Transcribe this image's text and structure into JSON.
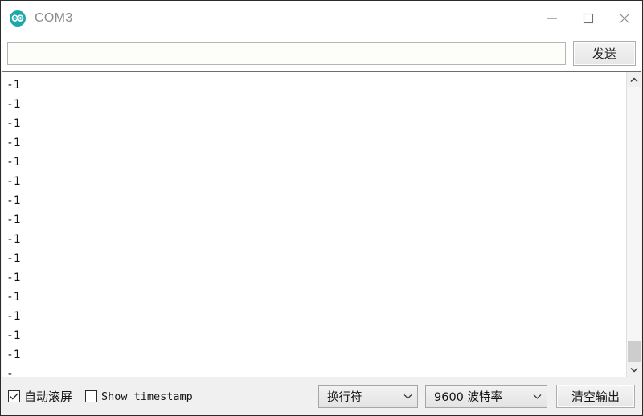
{
  "window": {
    "title": "COM3",
    "app_icon": "arduino-infinity-icon",
    "accent_color": "#00979c",
    "controls": {
      "minimize": "minimize-icon",
      "maximize": "maximize-icon",
      "close": "close-icon"
    }
  },
  "send_row": {
    "input_value": "",
    "input_placeholder": "",
    "send_label": "发送"
  },
  "console": {
    "lines": [
      "-1",
      "-1",
      "-1",
      "-1",
      "-1",
      "-1",
      "-1",
      "-1",
      "-1",
      "-1",
      "-1",
      "-1",
      "-1",
      "-1",
      "-1",
      "-"
    ]
  },
  "scrollbar": {
    "up_arrow": "chevron-up-icon",
    "down_arrow": "chevron-down-icon",
    "thumb_position": "bottom"
  },
  "bottom_bar": {
    "autoscroll": {
      "label": "自动滚屏",
      "checked": true
    },
    "show_timestamp": {
      "label": "Show timestamp",
      "checked": false
    },
    "newline_select": {
      "value": "换行符",
      "caret": "chevron-down-icon"
    },
    "baud_select": {
      "value": "9600 波特率",
      "caret": "chevron-down-icon"
    },
    "clear_button": {
      "label": "清空输出"
    }
  }
}
